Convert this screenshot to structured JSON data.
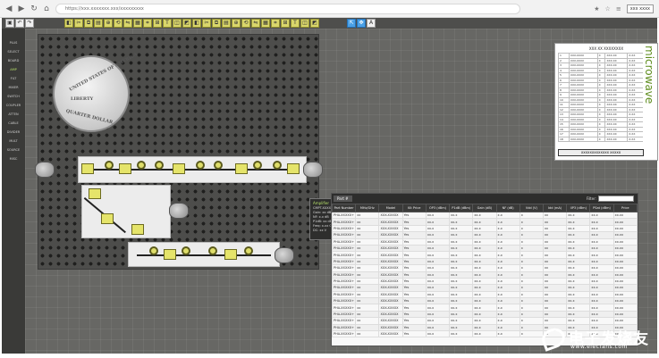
{
  "browser": {
    "url": "https://xxx.xxxxxxx.xxx/xxxxxxxxx",
    "profile_label": "xxx xxxx"
  },
  "toolbar": {
    "icons": [
      "save-icon",
      "undo-icon",
      "redo-icon",
      "cut-icon",
      "copy-icon",
      "paste-icon",
      "zoom-icon",
      "rotate-icon",
      "flip-icon",
      "grid-icon",
      "snap-icon",
      "measure-icon",
      "text-icon"
    ]
  },
  "sidebar": {
    "items": [
      {
        "label": "PLUS",
        "active": false
      },
      {
        "label": "SELECT",
        "active": false
      },
      {
        "label": "BOARD",
        "active": false
      },
      {
        "label": "AMP",
        "active": true
      },
      {
        "label": "FILT",
        "active": false
      },
      {
        "label": "MIXER",
        "active": false
      },
      {
        "label": "SWITCH",
        "active": false
      },
      {
        "label": "COUPLER",
        "active": false
      },
      {
        "label": "ATTEN",
        "active": false
      },
      {
        "label": "CABLE",
        "active": false
      },
      {
        "label": "DIVIDER",
        "active": false
      },
      {
        "label": "MULT",
        "active": false
      },
      {
        "label": "SOURCE",
        "active": false
      },
      {
        "label": "MISC",
        "active": false
      }
    ]
  },
  "coin": {
    "top_text": "UNITED STATES OF AMERICA",
    "liberty": "LIBERTY",
    "bottom_text": "QUARTER DOLLAR"
  },
  "tooltip": {
    "title": "Amplifier",
    "lines": [
      "CMPT-XXXX",
      "Gain: xx dB",
      "NF: x.x dB",
      "P1dB: xx dBm",
      "Freq: x-xx GHz",
      "DC: xx V"
    ]
  },
  "spec": {
    "title": "XXX XX XXXXXXXX",
    "rows": [
      [
        "1",
        "XXX-XXXX",
        "X",
        "XXX.XX",
        "X.XX"
      ],
      [
        "2",
        "XXX-XXXX",
        "X",
        "XXX.XX",
        "X.XX"
      ],
      [
        "3",
        "XXX-XXXX",
        "X",
        "XXX.XX",
        "X.XX"
      ],
      [
        "4",
        "XXX-XXXX",
        "X",
        "XXX.XX",
        "X.XX"
      ],
      [
        "5",
        "XXX-XXXX",
        "X",
        "XXX.XX",
        "X.XX"
      ],
      [
        "6",
        "XXX-XXXX",
        "X",
        "XXX.XX",
        "X.XX"
      ],
      [
        "7",
        "XXX-XXXX",
        "X",
        "XXX.XX",
        "X.XX"
      ],
      [
        "8",
        "XXX-XXXX",
        "X",
        "XXX.XX",
        "X.XX"
      ],
      [
        "9",
        "XXX-XXXX",
        "X",
        "XXX.XX",
        "X.XX"
      ],
      [
        "10",
        "XXX-XXXX",
        "X",
        "XXX.XX",
        "X.XX"
      ],
      [
        "11",
        "XXX-XXXX",
        "X",
        "XXX.XX",
        "X.XX"
      ],
      [
        "12",
        "XXX-XXXX",
        "X",
        "XXX.XX",
        "X.XX"
      ],
      [
        "13",
        "XXX-XXXX",
        "X",
        "XXX.XX",
        "X.XX"
      ],
      [
        "14",
        "XXX-XXXX",
        "X",
        "XXX.XX",
        "X.XX"
      ],
      [
        "15",
        "XXX-XXXX",
        "X",
        "XXX.XX",
        "X.XX"
      ],
      [
        "16",
        "XXX-XXXX",
        "X",
        "XXX.XX",
        "X.XX"
      ],
      [
        "17",
        "XXX-XXXX",
        "X",
        "XXX.XX",
        "X.XX"
      ],
      [
        "18",
        "XXX-XXXX",
        "X",
        "XXX.XX",
        "X.XX"
      ]
    ],
    "footer": "XXXXXXXXXXXXX XXXXX",
    "brand": "microwave"
  },
  "table": {
    "tab_label": "Part #",
    "filter_label": "Filter:",
    "filter_value": "",
    "headers": [
      "Part Number",
      "MHz/GHz",
      "Model",
      "Kit Price",
      "OP3 (dBm)",
      "P1dB (dBm)",
      "Gain (dB)",
      "NF (dB)",
      "Vdd (V)",
      "Idd (mA)",
      "IIP3 (dBm)",
      "PSat (dBm)",
      "Price"
    ],
    "rows": [
      [
        "PHA-XXXXX+",
        "xx",
        "XXX-XXXXX",
        "Yes",
        "xx.x",
        "xx.x",
        "xx.x",
        "x.x",
        "x",
        "xx",
        "xx.x",
        "xx.x",
        "xx.xx"
      ],
      [
        "PHA-XXXXX+",
        "xx",
        "XXX-XXXXX",
        "Yes",
        "xx.x",
        "xx.x",
        "xx.x",
        "x.x",
        "x",
        "xx",
        "xx.x",
        "xx.x",
        "xx.xx"
      ],
      [
        "PHA-XXXXX+",
        "xx",
        "XXX-XXXXX",
        "Yes",
        "xx.x",
        "xx.x",
        "xx.x",
        "x.x",
        "x",
        "xx",
        "xx.x",
        "xx.x",
        "xx.xx"
      ],
      [
        "PHA-XXXXX+",
        "xx",
        "XXX-XXXXX",
        "Yes",
        "xx.x",
        "xx.x",
        "xx.x",
        "x.x",
        "x",
        "xx",
        "xx.x",
        "xx.x",
        "xx.xx"
      ],
      [
        "PHA-XXXXX+",
        "xx",
        "XXX-XXXXX",
        "Yes",
        "xx.x",
        "xx.x",
        "xx.x",
        "x.x",
        "x",
        "xx",
        "xx.x",
        "xx.x",
        "xx.xx"
      ],
      [
        "PHA-XXXXX+",
        "xx",
        "XXX-XXXXX",
        "Yes",
        "xx.x",
        "xx.x",
        "xx.x",
        "x.x",
        "x",
        "xx",
        "xx.x",
        "xx.x",
        "xx.xx"
      ],
      [
        "PHA-XXXXX+",
        "xx",
        "XXX-XXXXX",
        "Yes",
        "xx.x",
        "xx.x",
        "xx.x",
        "x.x",
        "x",
        "xx",
        "xx.x",
        "xx.x",
        "xx.xx"
      ],
      [
        "PHA-XXXXX+",
        "xx",
        "XXX-XXXXX",
        "Yes",
        "xx.x",
        "xx.x",
        "xx.x",
        "x.x",
        "x",
        "xx",
        "xx.x",
        "xx.x",
        "xx.xx"
      ],
      [
        "PHA-XXXXX+",
        "xx",
        "XXX-XXXXX",
        "Yes",
        "xx.x",
        "xx.x",
        "xx.x",
        "x.x",
        "x",
        "xx",
        "xx.x",
        "xx.x",
        "xx.xx"
      ],
      [
        "PHA-XXXXX+",
        "xx",
        "XXX-XXXXX",
        "Yes",
        "xx.x",
        "xx.x",
        "xx.x",
        "x.x",
        "x",
        "xx",
        "xx.x",
        "xx.x",
        "xx.xx"
      ],
      [
        "PHA-XXXXX+",
        "xx",
        "XXX-XXXXX",
        "Yes",
        "xx.x",
        "xx.x",
        "xx.x",
        "x.x",
        "x",
        "xx",
        "xx.x",
        "xx.x",
        "xx.xx"
      ],
      [
        "PHA-XXXXX+",
        "xx",
        "XXX-XXXXX",
        "Yes",
        "xx.x",
        "xx.x",
        "xx.x",
        "x.x",
        "x",
        "xx",
        "xx.x",
        "xx.x",
        "xx.xx"
      ],
      [
        "PHA-XXXXX+",
        "xx",
        "XXX-XXXXX",
        "Yes",
        "xx.x",
        "xx.x",
        "xx.x",
        "x.x",
        "x",
        "xx",
        "xx.x",
        "xx.x",
        "xx.xx"
      ],
      [
        "PHA-XXXXX+",
        "xx",
        "XXX-XXXXX",
        "Yes",
        "xx.x",
        "xx.x",
        "xx.x",
        "x.x",
        "x",
        "xx",
        "xx.x",
        "xx.x",
        "xx.xx"
      ],
      [
        "PHA-XXXXX+",
        "xx",
        "XXX-XXXXX",
        "Yes",
        "xx.x",
        "xx.x",
        "xx.x",
        "x.x",
        "x",
        "xx",
        "xx.x",
        "xx.x",
        "xx.xx"
      ],
      [
        "PHA-XXXXX+",
        "xx",
        "XXX-XXXXX",
        "Yes",
        "xx.x",
        "xx.x",
        "xx.x",
        "x.x",
        "x",
        "xx",
        "xx.x",
        "xx.x",
        "xx.xx"
      ],
      [
        "PHA-XXXXX+",
        "xx",
        "XXX-XXXXX",
        "Yes",
        "xx.x",
        "xx.x",
        "xx.x",
        "x.x",
        "x",
        "xx",
        "xx.x",
        "xx.x",
        "xx.xx"
      ],
      [
        "PHA-XXXXX+",
        "xx",
        "XXX-XXXXX",
        "Yes",
        "xx.x",
        "xx.x",
        "xx.x",
        "x.x",
        "x",
        "xx",
        "xx.x",
        "xx.x",
        "xx.xx"
      ],
      [
        "PHA-XXXXX+",
        "xx",
        "XXX-XXXXX",
        "Yes",
        "xx.x",
        "xx.x",
        "xx.x",
        "x.x",
        "x",
        "xx",
        "xx.x",
        "xx.x",
        "xx.xx"
      ]
    ]
  },
  "watermark": {
    "cn": "电子发烧友",
    "en": "www.elecfans.com"
  },
  "colors": {
    "accent_green": "#5d8c1c",
    "component_yellow": "#e5e46a",
    "board_gray": "#4d4d4b",
    "canvas_gray": "#676764"
  }
}
